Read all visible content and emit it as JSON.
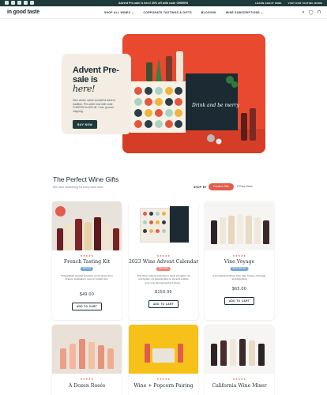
{
  "announcement": {
    "text": "Advent Pre-sale is here! 20% off with code CHEERS",
    "links": [
      "LEARN ABOUT WINE",
      "VISIT OUR TASTING ROOM"
    ]
  },
  "header": {
    "logo": "in good taste",
    "nav": [
      "SHOP ALL WINES ⌄",
      "CORPORATE TASTINGS & GIFTS",
      "BLOG/INK",
      "WINE SUBSCRIPTIONS ⌄"
    ],
    "icons": [
      "search-icon",
      "account-icon",
      "cart-icon"
    ]
  },
  "hero": {
    "title_main": "Advent Pre-sale is ",
    "title_accent": "here!",
    "body": "New wines, same wonderful Advent tradition. Pre-order now with code CHEERS for $20 off + free ground shipping.",
    "button": "BUY NOW",
    "photo_sign": "Drink and be merry"
  },
  "section": {
    "title": "The Perfect Wine Gifts",
    "subtitle": "We have something for every wine lover.",
    "shop_by_label": "SHOP BY",
    "filters": [
      "Curated Gifts",
      "# Pack Sizes"
    ]
  },
  "products": [
    {
      "name": "French Tasting Kit",
      "stars": "★★★★★",
      "badge": "NEW KIT",
      "description": "Thoughtfully curated selection of red wines from France, Australia & more in 6 pack size.",
      "price": "$49.00",
      "button": "ADD TO CART"
    },
    {
      "name": "2023 Wine Advent Calendar",
      "stars": "★★★★★",
      "badge": "PRE-SALE",
      "description": "This Wine Advent Calendar is back! 24 nights. 24 red bottles. 24 opportunities to sip and explore your new through world of wines...",
      "price": "$159.99",
      "button": "ADD TO CART"
    },
    {
      "name": "Vine Voyage",
      "stars": "★★★★★",
      "badge": "BEST SELLER",
      "description": "6 International Wines from Italy, France, Portugal, and Argentina",
      "price": "$65.00",
      "button": "ADD TO CART"
    },
    {
      "name": "A Dozen Rosés",
      "stars": "★★★★★"
    },
    {
      "name": "Wine + Popcorn Pairing",
      "stars": "★★★★★"
    },
    {
      "name": "California Wine Mixer",
      "stars": "★★★★★"
    }
  ],
  "colors": {
    "brand_dark": "#1e3a3a",
    "accent": "#e25c4b",
    "hero_photo": "#e9492f",
    "hero_card": "#f3ede4"
  }
}
